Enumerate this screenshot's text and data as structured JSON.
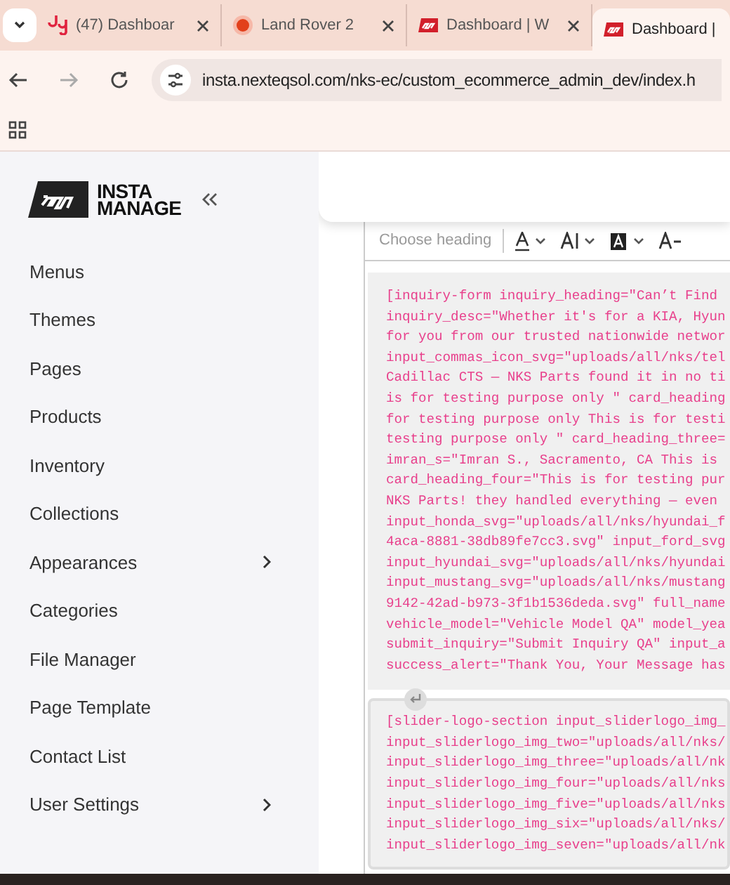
{
  "browser": {
    "tabs": [
      {
        "title": "(47) Dashboar",
        "kind": "letters",
        "selected": false
      },
      {
        "title": "Land Rover 2",
        "kind": "dot",
        "selected": false
      },
      {
        "title": "Dashboard | W",
        "kind": "logo",
        "selected": false
      },
      {
        "title": "Dashboard |",
        "kind": "logo",
        "selected": true
      }
    ],
    "url": "insta.nexteqsol.com/nks-ec/custom_ecommerce_admin_dev/index.h"
  },
  "sidebar": {
    "logo": [
      "INSTA",
      "MANAGE"
    ],
    "items": [
      {
        "label": "Menus",
        "expandable": false
      },
      {
        "label": "Themes",
        "expandable": false
      },
      {
        "label": "Pages",
        "expandable": false
      },
      {
        "label": "Products",
        "expandable": false
      },
      {
        "label": "Inventory",
        "expandable": false
      },
      {
        "label": "Collections",
        "expandable": false
      },
      {
        "label": "Appearances",
        "expandable": true
      },
      {
        "label": "Categories",
        "expandable": false
      },
      {
        "label": "File Manager",
        "expandable": false
      },
      {
        "label": "Page Template",
        "expandable": false
      },
      {
        "label": "Contact List",
        "expandable": false
      },
      {
        "label": "User Settings",
        "expandable": true
      }
    ]
  },
  "editor": {
    "heading_select": "Choose heading",
    "code_blocks": [
      {
        "lines": [
          "[inquiry-form inquiry_heading=\"Can’t Find",
          "inquiry_desc=\"Whether it's for a KIA, Hyun",
          "for you from our trusted nationwide networ",
          "input_commas_icon_svg=\"uploads/all/nks/tel",
          "Cadillac CTS — NKS Parts found it in no ti",
          "is for testing purpose only \" card_heading",
          "for testing purpose only This is for testi",
          "testing purpose only \" card_heading_three=",
          "imran_s=\"Imran S., Sacramento, CA This is",
          "card_heading_four=\"This is for testing pur",
          "NKS Parts! they handled everything — even",
          "input_honda_svg=\"uploads/all/nks/hyundai_f",
          "4aca-8881-38db89fe7cc3.svg\" input_ford_svg",
          "input_hyundai_svg=\"uploads/all/nks/hyundai",
          "input_mustang_svg=\"uploads/all/nks/mustang",
          "9142-42ad-b973-3f1b1536deda.svg\" full_name",
          "vehicle_model=\"Vehicle Model QA\" model_yea",
          "submit_inquiry=\"Submit Inquiry QA\" input_a",
          "success_alert=\"Thank You, Your Message has"
        ],
        "selected": false
      },
      {
        "lines": [
          "[slider-logo-section input_sliderlogo_img_",
          "input_sliderlogo_img_two=\"uploads/all/nks/",
          "input_sliderlogo_img_three=\"uploads/all/nk",
          "input_sliderlogo_img_four=\"uploads/all/nks",
          "input_sliderlogo_img_five=\"uploads/all/nks",
          "input_sliderlogo_img_six=\"uploads/all/nks/",
          "input_sliderlogo_img_seven=\"uploads/all/nk"
        ],
        "selected": true
      }
    ]
  }
}
